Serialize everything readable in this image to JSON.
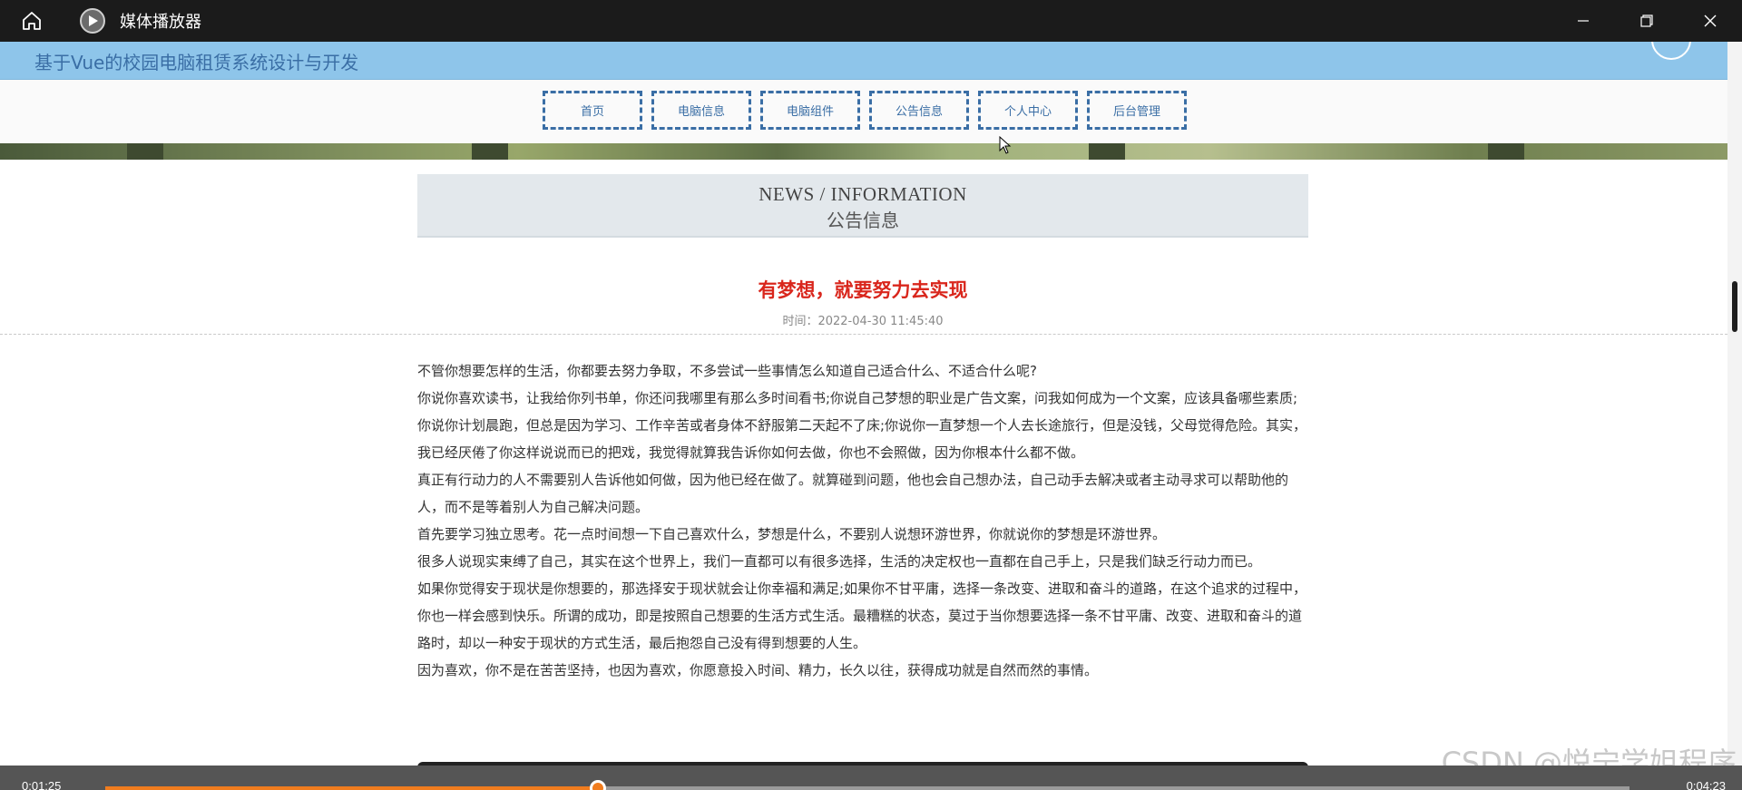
{
  "window": {
    "title": "媒体播放器",
    "controls": [
      "minimize-icon",
      "restore-icon",
      "close-icon"
    ]
  },
  "site": {
    "title": "基于Vue的校园电脑租赁系统设计与开发",
    "header_color": "#8ec5ea",
    "accent": "#3a6ea5"
  },
  "nav": {
    "items": [
      "首页",
      "电脑信息",
      "电脑组件",
      "公告信息",
      "个人中心",
      "后台管理"
    ]
  },
  "news": {
    "en": "NEWS / INFORMATION",
    "cn": "公告信息"
  },
  "article": {
    "title": "有梦想，就要努力去实现",
    "time": "时间：2022-04-30 11:45:40",
    "title_color": "#d9261c",
    "paragraphs": [
      "不管你想要怎样的生活，你都要去努力争取，不多尝试一些事情怎么知道自己适合什么、不适合什么呢?",
      "你说你喜欢读书，让我给你列书单，你还问我哪里有那么多时间看书;你说自己梦想的职业是广告文案，问我如何成为一个文案，应该具备哪些素质;你说你计划晨跑，但总是因为学习、工作辛苦或者身体不舒服第二天起不了床;你说你一直梦想一个人去长途旅行，但是没钱，父母觉得危险。其实，我已经厌倦了你这样说说而已的把戏，我觉得就算我告诉你如何去做，你也不会照做，因为你根本什么都不做。",
      "真正有行动力的人不需要别人告诉他如何做，因为他已经在做了。就算碰到问题，他也会自己想办法，自己动手去解决或者主动寻求可以帮助他的人，而不是等着别人为自己解决问题。",
      "首先要学习独立思考。花一点时间想一下自己喜欢什么，梦想是什么，不要别人说想环游世界，你就说你的梦想是环游世界。",
      "很多人说现实束缚了自己，其实在这个世界上，我们一直都可以有很多选择，生活的决定权也一直都在自己手上，只是我们缺乏行动力而已。",
      "如果你觉得安于现状是你想要的，那选择安于现状就会让你幸福和满足;如果你不甘平庸，选择一条改变、进取和奋斗的道路，在这个追求的过程中，你也一样会感到快乐。所谓的成功，即是按照自己想要的生活方式生活。最糟糕的状态，莫过于当你想要选择一条不甘平庸、改变、进取和奋斗的道路时，却以一种安于现状的方式生活，最后抱怨自己没有得到想要的人生。",
      "因为喜欢，你不是在苦苦坚持，也因为喜欢，你愿意投入时间、精力，长久以往，获得成功就是自然而然的事情。"
    ]
  },
  "watermark": "CSDN @悦宁学姐程序",
  "player": {
    "current_time": "0:01:25",
    "total_time": "0:04:23",
    "progress_fraction": 0.323,
    "accent": "#f07c1e"
  }
}
